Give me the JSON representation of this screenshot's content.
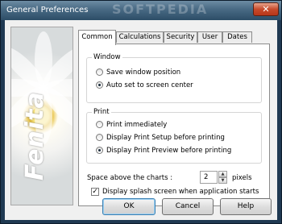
{
  "window": {
    "title": "General Preferences",
    "watermark": "SOFTPEDIA",
    "close_glyph": "✕"
  },
  "banner": {
    "brand": "Fenita"
  },
  "tabs": [
    {
      "label": "Common",
      "active": true
    },
    {
      "label": "Calculations",
      "active": false
    },
    {
      "label": "Security",
      "active": false
    },
    {
      "label": "User",
      "active": false
    },
    {
      "label": "Dates",
      "active": false
    }
  ],
  "window_group": {
    "legend": "Window",
    "options": [
      {
        "label": "Save window position",
        "selected": false
      },
      {
        "label": "Auto set to screen center",
        "selected": true
      }
    ]
  },
  "print_group": {
    "legend": "Print",
    "options": [
      {
        "label": "Print immediately",
        "selected": false
      },
      {
        "label": "Display Print Setup before printing",
        "selected": false
      },
      {
        "label": "Display Print Preview before printing",
        "selected": true
      }
    ]
  },
  "space": {
    "label": "Space above the charts :",
    "value": "2",
    "unit": "pixels"
  },
  "splash": {
    "label": "Display splash screen when application starts",
    "checked": true,
    "check_glyph": "✓"
  },
  "buttons": {
    "ok": "OK",
    "cancel": "Cancel",
    "help": "Help"
  }
}
